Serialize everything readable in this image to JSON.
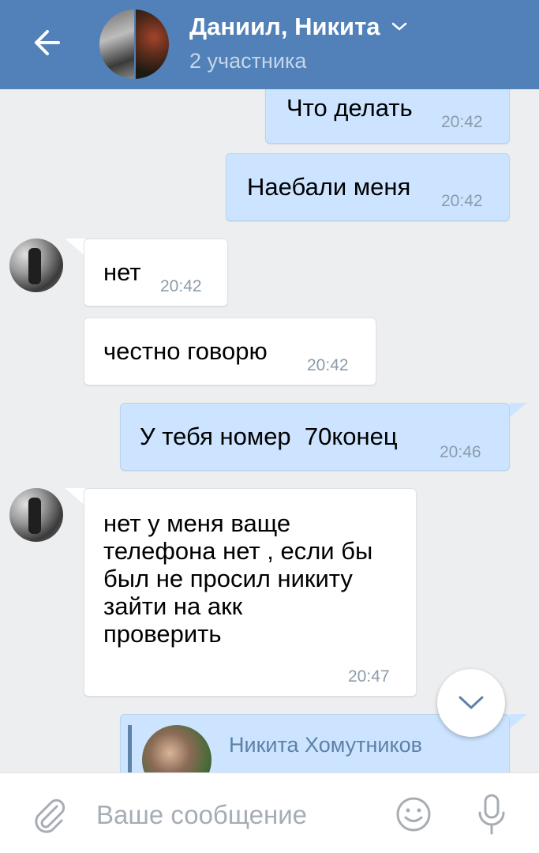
{
  "header": {
    "title": "Даниил, Никита",
    "subtitle": "2 участника",
    "colors": {
      "bar": "#5181b8",
      "subtitle": "#c6d6ea"
    }
  },
  "messages": [
    {
      "id": "m1",
      "direction": "out",
      "text": "Что делать",
      "time": "20:42"
    },
    {
      "id": "m2",
      "direction": "out",
      "text": "Наебали меня",
      "time": "20:42"
    },
    {
      "id": "m3",
      "direction": "in",
      "text": "нет",
      "time": "20:42"
    },
    {
      "id": "m4",
      "direction": "in",
      "text": "честно говорю",
      "time": "20:42"
    },
    {
      "id": "m5",
      "direction": "out",
      "text": "У тебя номер  70конец",
      "time": "20:46"
    },
    {
      "id": "m6",
      "direction": "in",
      "text": "нет у меня ваще\nтелефона нет , если бы\nбыл не просил никиту\nзайти на акк\nпроверить",
      "time": "20:47"
    }
  ],
  "forwarded": {
    "author": "Никита Хомутников"
  },
  "compose": {
    "placeholder": "Ваше сообщение"
  },
  "icons": {
    "back": "arrow-left-icon",
    "dropdown": "chevron-down-icon",
    "scroll": "chevron-down-icon",
    "attach": "paperclip-icon",
    "emoji": "smile-icon",
    "voice": "microphone-icon"
  },
  "colors": {
    "outgoing": "#cce4ff",
    "incoming": "#ffffff",
    "background": "#edeef0",
    "time": "#8c9bab",
    "link": "#5e81a8"
  }
}
